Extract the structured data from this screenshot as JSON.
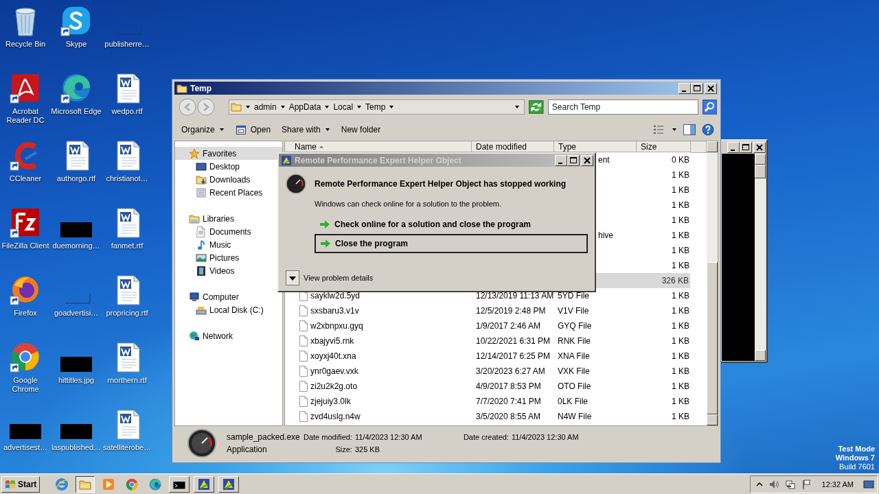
{
  "desktop_icons": [
    {
      "label": "Recycle Bin",
      "kind": "recycle",
      "shortcut": false
    },
    {
      "label": "Acrobat Reader DC",
      "kind": "acrobat",
      "shortcut": true
    },
    {
      "label": "CCleaner",
      "kind": "ccleaner",
      "shortcut": true
    },
    {
      "label": "FileZilla Client",
      "kind": "filezilla",
      "shortcut": true
    },
    {
      "label": "Firefox",
      "kind": "firefox",
      "shortcut": true
    },
    {
      "label": "Google Chrome",
      "kind": "chrome",
      "shortcut": true
    },
    {
      "label": "advertisest…",
      "kind": "image",
      "shortcut": false
    },
    {
      "label": "Skype",
      "kind": "skype",
      "shortcut": true
    },
    {
      "label": "Microsoft Edge",
      "kind": "edge",
      "shortcut": true
    },
    {
      "label": "authorgo.rtf",
      "kind": "word",
      "shortcut": false
    },
    {
      "label": "duemorning…",
      "kind": "image",
      "shortcut": false
    },
    {
      "label": "goadvertisi…",
      "kind": "blank",
      "shortcut": false
    },
    {
      "label": "hittitles.jpg",
      "kind": "image",
      "shortcut": false
    },
    {
      "label": "laspublished…",
      "kind": "image",
      "shortcut": false
    },
    {
      "label": "publisherre…",
      "kind": "blank",
      "shortcut": false
    },
    {
      "label": "wedpo.rtf",
      "kind": "word",
      "shortcut": false
    },
    {
      "label": "christianot…",
      "kind": "word",
      "shortcut": false
    },
    {
      "label": "fanmet.rtf",
      "kind": "word",
      "shortcut": false
    },
    {
      "label": "propricing.rtf",
      "kind": "word",
      "shortcut": false
    },
    {
      "label": "rnorthern.rtf",
      "kind": "word",
      "shortcut": false
    },
    {
      "label": "satelliterobe…",
      "kind": "word",
      "shortcut": false
    }
  ],
  "explorer": {
    "title": "Temp",
    "breadcrumb": [
      "admin",
      "AppData",
      "Local",
      "Temp"
    ],
    "search": {
      "placeholder": "Search Temp"
    },
    "commands": [
      {
        "label": "Organize",
        "kind": "menu"
      },
      {
        "label": "Open",
        "kind": "open"
      },
      {
        "label": "Share with",
        "kind": "menu"
      },
      {
        "label": "New folder",
        "kind": "plain"
      }
    ],
    "nav": [
      {
        "label": "Favorites",
        "kind": "star",
        "selected": true,
        "children": [
          {
            "label": "Desktop",
            "kind": "desktop",
            "selected": false
          },
          {
            "label": "Downloads",
            "kind": "downloads",
            "selected": false
          },
          {
            "label": "Recent Places",
            "kind": "recent",
            "selected": false
          }
        ]
      },
      {
        "label": "Libraries",
        "kind": "library",
        "selected": false,
        "children": [
          {
            "label": "Documents",
            "kind": "documents",
            "selected": false
          },
          {
            "label": "Music",
            "kind": "music",
            "selected": false
          },
          {
            "label": "Pictures",
            "kind": "pictures",
            "selected": false
          },
          {
            "label": "Videos",
            "kind": "videos",
            "selected": false
          }
        ]
      },
      {
        "label": "Computer",
        "kind": "computer",
        "selected": false,
        "children": [
          {
            "label": "Local Disk (C:)",
            "kind": "disk",
            "selected": false
          }
        ]
      },
      {
        "label": "Network",
        "kind": "network",
        "selected": false
      }
    ],
    "columns": [
      {
        "label": "Name",
        "sorted": true
      },
      {
        "label": "Date modified",
        "sorted": false
      },
      {
        "label": "Type",
        "sorted": false
      },
      {
        "label": "Size",
        "sorted": false
      }
    ],
    "rows": [
      {
        "type": "ent",
        "size": "0 KB",
        "selected": false
      },
      {
        "size": "1 KB",
        "selected": false
      },
      {
        "size": "1 KB",
        "selected": false
      },
      {
        "size": "1 KB",
        "selected": false
      },
      {
        "size": "1 KB",
        "selected": false
      },
      {
        "type": "hive",
        "size": "1 KB",
        "selected": false
      },
      {
        "size": "1 KB",
        "selected": false
      },
      {
        "size": "1 KB",
        "selected": false
      },
      {
        "size": "326 KB",
        "selected": true
      },
      {
        "name": "sayklw2d.5yd",
        "date": "12/13/2019 11:13 AM",
        "type": "5YD File",
        "size": "1 KB",
        "selected": false
      },
      {
        "name": "sxsbaru3.v1v",
        "date": "12/5/2019 2:48 PM",
        "type": "V1V File",
        "size": "1 KB",
        "selected": false
      },
      {
        "name": "w2xbnpxu.gyq",
        "date": "1/9/2017 2:46 AM",
        "type": "GYQ File",
        "size": "1 KB",
        "selected": false
      },
      {
        "name": "xbajyvi5.rnk",
        "date": "10/22/2021 6:31 PM",
        "type": "RNK File",
        "size": "1 KB",
        "selected": false
      },
      {
        "name": "xoyxj40t.xna",
        "date": "12/14/2017 6:25 PM",
        "type": "XNA File",
        "size": "1 KB",
        "selected": false
      },
      {
        "name": "ynr0gaev.vxk",
        "date": "3/20/2023 6:27 AM",
        "type": "VXK File",
        "size": "1 KB",
        "selected": false
      },
      {
        "name": "zi2u2k2g.oto",
        "date": "4/9/2017 8:53 PM",
        "type": "OTO File",
        "size": "1 KB",
        "selected": false
      },
      {
        "name": "zjejuiy3.0lk",
        "date": "7/7/2020 7:41 PM",
        "type": "0LK File",
        "size": "1 KB",
        "selected": false
      },
      {
        "name": "zvd4uslg.n4w",
        "date": "3/5/2020 8:55 AM",
        "type": "N4W File",
        "size": "1 KB",
        "selected": false
      }
    ],
    "details": {
      "name": "sample_packed.exe",
      "type": "Application",
      "fields": [
        {
          "label": "Date modified:",
          "value": "11/4/2023 12:30 AM"
        },
        {
          "label": "Date created:",
          "value": "11/4/2023 12:30 AM"
        },
        {
          "label": "Size:",
          "value": "325 KB"
        }
      ]
    }
  },
  "error_dialog": {
    "title": "Remote Performance Expert Helper Object",
    "heading": "Remote Performance Expert Helper Object has stopped working",
    "message": "Windows can check online for a solution to the problem.",
    "options": [
      {
        "label": "Check online for a solution and close the program",
        "focused": false
      },
      {
        "label": "Close the program",
        "focused": true
      }
    ],
    "details_toggle": "View problem details"
  },
  "os_notice": [
    "Test Mode",
    "Windows 7",
    "Build 7601"
  ],
  "taskbar": {
    "start": "Start",
    "apps": [
      {
        "kind": "ie",
        "active": false
      },
      {
        "kind": "explorer",
        "active": true
      },
      {
        "kind": "media",
        "active": false
      },
      {
        "kind": "chrome",
        "active": false
      },
      {
        "kind": "edge",
        "active": false
      },
      {
        "kind": "console",
        "active": false
      },
      {
        "kind": "app",
        "active": false
      },
      {
        "kind": "app",
        "active": false
      }
    ],
    "clock": "12:32 AM"
  }
}
